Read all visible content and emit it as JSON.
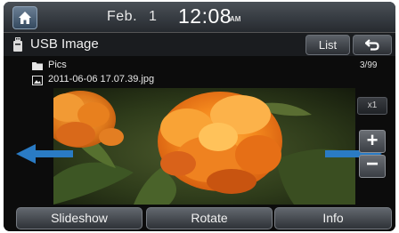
{
  "status_bar": {
    "date_month": "Feb.",
    "date_day": "1",
    "time": "12:08",
    "ampm": "AM"
  },
  "title_bar": {
    "title": "USB Image",
    "list_label": "List",
    "back_icon": "back-arrow-icon",
    "source_icon": "usb-drive-icon"
  },
  "file_info": {
    "folder": "Pics",
    "file": "2011-06-06 17.07.39.jpg",
    "counter": "3/99"
  },
  "controls": {
    "zoom_level": "x1",
    "zoom_in": "+",
    "zoom_out": "−",
    "prev_icon": "arrow-left-icon",
    "next_icon": "arrow-right-icon"
  },
  "bottom_bar": {
    "buttons": [
      "Slideshow",
      "Rotate",
      "Info"
    ]
  },
  "colors": {
    "accent_arrow": "#2a7bc4",
    "flower": "#f5821e",
    "background": "#0c0c0c"
  }
}
